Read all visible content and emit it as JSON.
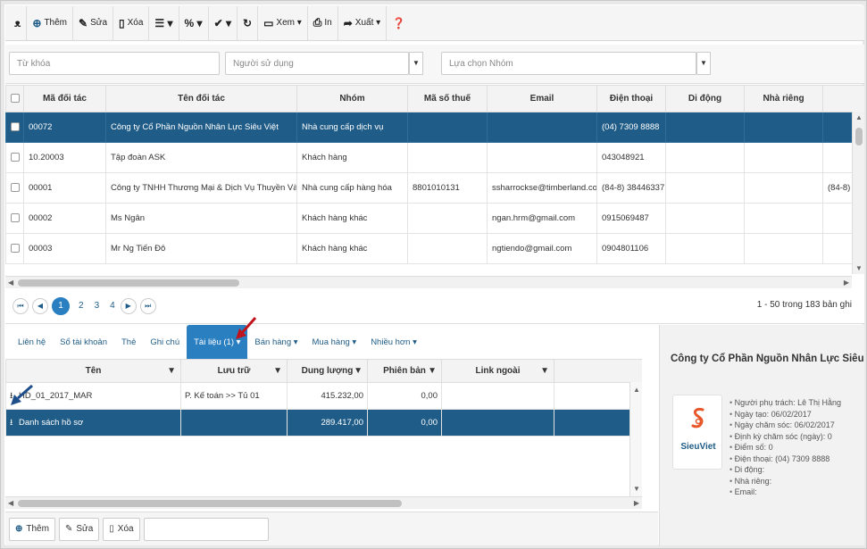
{
  "toolbar": {
    "items": [
      {
        "icon": "binoculars-icon",
        "glyph": "⌕",
        "label": ""
      },
      {
        "icon": "plus-circle-icon",
        "glyph": "⊕",
        "label": "Thêm"
      },
      {
        "icon": "pencil-icon",
        "glyph": "✎",
        "label": "Sửa"
      },
      {
        "icon": "trash-icon",
        "glyph": "🗑",
        "label": "Xóa"
      },
      {
        "icon": "list-icon",
        "glyph": "☰ ▾",
        "label": ""
      },
      {
        "icon": "percent-icon",
        "glyph": "% ▾",
        "label": ""
      },
      {
        "icon": "check-circle-icon",
        "glyph": "✔ ▾",
        "label": ""
      },
      {
        "icon": "refresh-icon",
        "glyph": "↻",
        "label": ""
      },
      {
        "icon": "view-icon",
        "glyph": "▭",
        "label": "Xem ▾"
      },
      {
        "icon": "print-icon",
        "glyph": "⎙",
        "label": "In"
      },
      {
        "icon": "export-icon",
        "glyph": "➦",
        "label": "Xuất ▾"
      },
      {
        "icon": "help-icon",
        "glyph": "?",
        "label": ""
      }
    ]
  },
  "filters": {
    "keyword_placeholder": "Từ khóa",
    "user_placeholder": "Người sử dụng",
    "group_placeholder": "Lựa chọn Nhóm"
  },
  "grid": {
    "headers": [
      "",
      "Mã đối tác",
      "Tên đối tác",
      "Nhóm",
      "Mã số thuế",
      "Email",
      "Điện thoại",
      "Di động",
      "Nhà riêng",
      ""
    ],
    "rows": [
      [
        "00072",
        "Công ty Cổ Phần Nguồn Nhân Lực Siêu Việt",
        "Nhà cung cấp dịch vụ",
        "",
        "",
        "(04) 7309 8888",
        "",
        "",
        ""
      ],
      [
        "10.20003",
        "Tập đoàn ASK",
        "Khách hàng",
        "",
        "",
        "043048921",
        "",
        "",
        ""
      ],
      [
        "00001",
        "Công ty TNHH Thương Mại & Dịch Vụ Thuyền Vàng - Vpđd",
        "Nhà cung cấp hàng hóa",
        "8801010131",
        "ssharrockse@timberland.com",
        "(84-8) 38446337",
        "",
        "",
        "(84-8)"
      ],
      [
        "00002",
        "Ms Ngân",
        "Khách hàng khác",
        "",
        "ngan.hrm@gmail.com",
        "0915069487",
        "",
        "",
        ""
      ],
      [
        "00003",
        "Mr Ng Tiến Đô",
        "Khách hàng khác",
        "",
        "ngtiendo@gmail.com",
        "0904801106",
        "",
        "",
        ""
      ]
    ]
  },
  "pager": {
    "pages": [
      "1",
      "2",
      "3",
      "4"
    ],
    "info": "1 - 50 trong 183 bản ghi"
  },
  "tabs": [
    "Liên hệ",
    "Sổ tài khoản",
    "Thẻ",
    "Ghi chú",
    "Tài liệu (1) ▾",
    "Bán hàng ▾",
    "Mua hàng ▾",
    "Nhiều hơn ▾"
  ],
  "docs": {
    "headers": [
      "Tên",
      "Lưu trữ",
      "Dung lượng",
      "Phiên bản",
      "Link ngoài"
    ],
    "rows": [
      [
        "HD_01_2017_MAR",
        "P. Kế toán >> Tủ 01",
        "415.232,00",
        "0,00",
        ""
      ],
      [
        "Danh sách hồ sơ",
        "",
        "289.417,00",
        "0,00",
        ""
      ]
    ]
  },
  "bottombar": {
    "add": "Thêm",
    "edit": "Sửa",
    "delete": "Xóa"
  },
  "panel": {
    "title": "Công ty Cổ Phần Nguồn Nhân Lực Siêu Việ",
    "logo_text": "SieuViet",
    "details": [
      "Người phụ trách: Lê Thị Hằng",
      "Ngày tạo: 06/02/2017",
      "Ngày chăm sóc: 06/02/2017",
      "Định kỳ chăm sóc (ngày): 0",
      "Điểm số: 0",
      "Điện thoại: (04) 7309 8888",
      "Di động:",
      "Nhà riêng:",
      "Email:"
    ]
  },
  "colors": {
    "accent": "#2a7fc1",
    "selected_row": "#1f5c87",
    "annotation_arrow": "#c0141c"
  }
}
